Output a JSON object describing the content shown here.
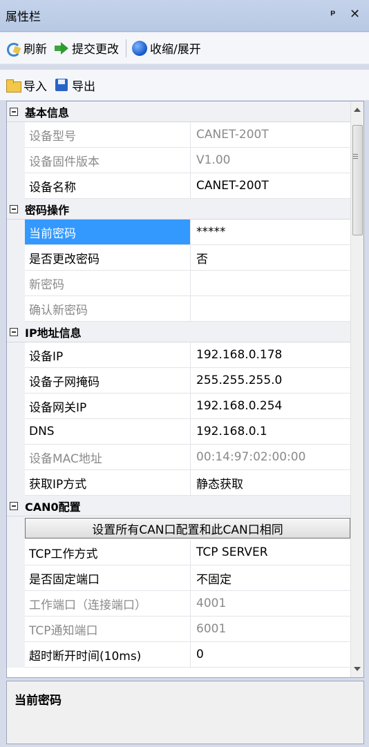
{
  "title": "属性栏",
  "toolbar1": [
    {
      "label": "刷新",
      "icon": "refresh-icon"
    },
    {
      "label": "提交更改",
      "icon": "submit-arrow-icon"
    },
    {
      "label": "收缩/展开",
      "icon": "globe-icon"
    }
  ],
  "toolbar2": [
    {
      "label": "导入",
      "icon": "folder-icon"
    },
    {
      "label": "导出",
      "icon": "save-icon"
    }
  ],
  "categories": {
    "basic": {
      "title": "基本信息",
      "rows": [
        {
          "name": "设备型号",
          "value": "CANET-200T"
        },
        {
          "name": "设备固件版本",
          "value": "V1.00"
        },
        {
          "name": "设备名称",
          "value": "CANET-200T"
        }
      ]
    },
    "password": {
      "title": "密码操作",
      "rows": [
        {
          "name": "当前密码",
          "value": "*****"
        },
        {
          "name": "是否更改密码",
          "value": "否"
        },
        {
          "name": "新密码",
          "value": ""
        },
        {
          "name": "确认新密码",
          "value": ""
        }
      ]
    },
    "ip": {
      "title": "IP地址信息",
      "rows": [
        {
          "name": "设备IP",
          "value": "192.168.0.178"
        },
        {
          "name": "设备子网掩码",
          "value": "255.255.255.0"
        },
        {
          "name": "设备网关IP",
          "value": "192.168.0.254"
        },
        {
          "name": "DNS",
          "value": "192.168.0.1"
        },
        {
          "name": "设备MAC地址",
          "value": "00:14:97:02:00:00"
        },
        {
          "name": "获取IP方式",
          "value": "静态获取"
        }
      ]
    },
    "can0": {
      "title": "CAN0配置",
      "button": "设置所有CAN口配置和此CAN口相同",
      "rows": [
        {
          "name": "TCP工作方式",
          "value": "TCP SERVER"
        },
        {
          "name": "是否固定端口",
          "value": "不固定"
        },
        {
          "name": "工作端口（连接端口）",
          "value": "4001"
        },
        {
          "name": "TCP通知端口",
          "value": "6001"
        },
        {
          "name": "超时断开时间(10ms)",
          "value": "0"
        }
      ]
    }
  },
  "description": {
    "title": "当前密码"
  },
  "colors": {
    "selection": "#3399ff",
    "titlebar": "#c4d3ea"
  }
}
